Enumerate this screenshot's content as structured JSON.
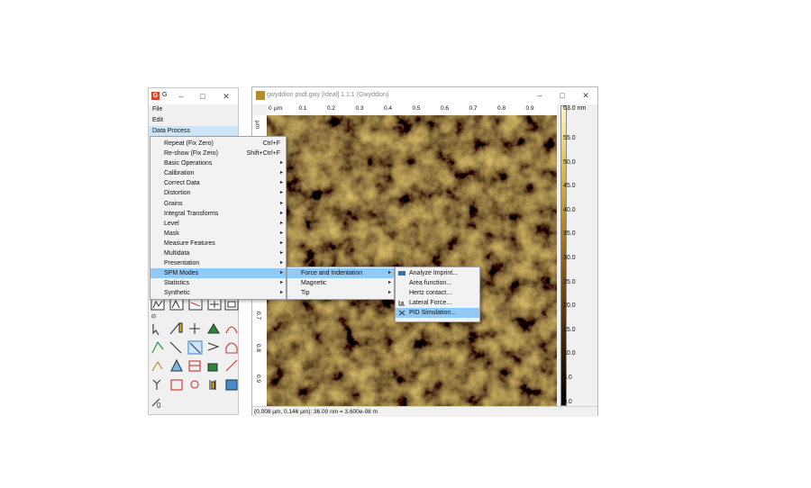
{
  "main_window": {
    "title": "G",
    "app_icon_letter": "G",
    "menubar": {
      "file": "File",
      "edit": "Edit",
      "data_process": "Data Process"
    },
    "tools_label": "Tools"
  },
  "data_process_menu": [
    {
      "label": "Repeat (Fix Zero)",
      "shortcut": "Ctrl+F"
    },
    {
      "label": "Re-show (Fix Zero)",
      "shortcut": "Shift+Ctrl+F"
    },
    {
      "label": "Basic Operations",
      "submenu": true
    },
    {
      "label": "Calibration",
      "submenu": true
    },
    {
      "label": "Correct Data",
      "submenu": true
    },
    {
      "label": "Distortion",
      "submenu": true
    },
    {
      "label": "Grains",
      "submenu": true
    },
    {
      "label": "Integral Transforms",
      "submenu": true
    },
    {
      "label": "Level",
      "submenu": true
    },
    {
      "label": "Mask",
      "submenu": true
    },
    {
      "label": "Measure Features",
      "submenu": true
    },
    {
      "label": "Multidata",
      "submenu": true
    },
    {
      "label": "Presentation",
      "submenu": true
    },
    {
      "label": "SPM Modes",
      "submenu": true,
      "highlighted": true
    },
    {
      "label": "Statistics",
      "submenu": true
    },
    {
      "label": "Synthetic",
      "submenu": true
    }
  ],
  "spm_modes_menu": [
    {
      "label": "Force and Indentation",
      "submenu": true,
      "highlighted": true
    },
    {
      "label": "Magnetic",
      "submenu": true
    },
    {
      "label": "Tip",
      "submenu": true
    }
  ],
  "force_menu": [
    {
      "label": "Analyze Imprint...",
      "icon": "imprint-icon"
    },
    {
      "label": "Area function...",
      "icon": ""
    },
    {
      "label": "Hertz contact...",
      "icon": ""
    },
    {
      "label": "Lateral Force...",
      "icon": "lateral-force-icon"
    },
    {
      "label": "PID Simulation...",
      "icon": "pid-icon",
      "highlighted": true
    }
  ],
  "data_window": {
    "title": "gwyddion psdf.gwy [Ideal] 1.1:1 (Gwyddion)",
    "x_ruler_unit": "µm",
    "x_ticks": [
      "0",
      "0.1",
      "0.2",
      "0.3",
      "0.4",
      "0.5",
      "0.6",
      "0.7",
      "0.8",
      "0.9"
    ],
    "y_ruler_unit": "µm",
    "y_ticks": [
      "0",
      "0.7",
      "0.8",
      "0.9"
    ],
    "colorbar_max": "63.0 nm",
    "colorbar_labels": [
      "55.0",
      "50.0",
      "45.0",
      "40.0",
      "35.0",
      "30.0",
      "25.0",
      "20.0",
      "15.0",
      "10.0",
      "5.0",
      "0.0"
    ],
    "status": "(0.008 µm, 0.146 µm): 36.00 nm = 3.600e-08 m"
  },
  "colors": {
    "menu_highlight": "#91c9f7",
    "active_menubar": "#cce4f7",
    "surface_dark": "#6b4208",
    "surface_light": "#e8c24a"
  }
}
